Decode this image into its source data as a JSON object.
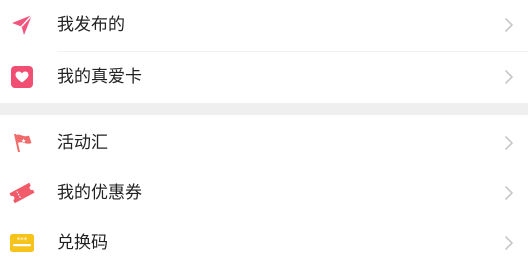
{
  "menu_group_1": {
    "items": [
      {
        "label": "我发布的",
        "icon": "paper-plane-icon",
        "icon_color": "#f2557d"
      },
      {
        "label": "我的真爱卡",
        "icon": "heart-card-icon",
        "icon_color": "#f04f73"
      }
    ]
  },
  "menu_group_2": {
    "items": [
      {
        "label": "活动汇",
        "icon": "flag-icon",
        "icon_color": "#f26b6b"
      },
      {
        "label": "我的优惠券",
        "icon": "coupon-ticket-icon",
        "icon_color": "#f25b6a"
      },
      {
        "label": "兑换码",
        "icon": "redeem-code-card-icon",
        "icon_color": "#f6c31b"
      }
    ]
  },
  "colors": {
    "text": "#222222",
    "chevron": "#c7c7c7",
    "divider": "#efefef"
  }
}
